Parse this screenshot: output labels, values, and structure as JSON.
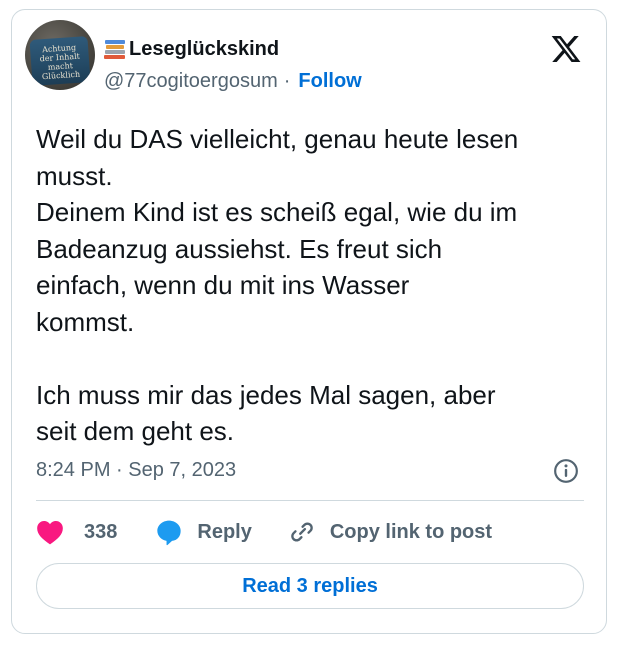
{
  "author": {
    "display_name": "Leseglückskind",
    "name_emoji": "books-emoji",
    "handle": "@77cogitoergosum",
    "separator": "·",
    "follow_label": "Follow",
    "avatar_mug_text": "Achtung\nder Inhalt\nmacht\nGlücklich"
  },
  "platform_logo": "x-logo-icon",
  "tweet": {
    "text": "Weil du DAS vielleicht, genau heute lesen\nmusst.\nDeinem Kind ist es scheiß egal, wie du im\nBadeanzug aussiehst. Es freut sich\neinfach, wenn du mit ins Wasser\nkommst.\n\nIch muss mir das jedes Mal sagen, aber\nseit dem geht es.",
    "timestamp": "8:24 PM · Sep 7, 2023"
  },
  "actions": {
    "like_count": "338",
    "reply_label": "Reply",
    "copy_link_label": "Copy link to post"
  },
  "read_replies_label": "Read 3 replies",
  "colors": {
    "link_blue": "#006fd6",
    "heart_pink": "#f91880",
    "reply_blue": "#1d9bf0",
    "muted_gray": "#536471",
    "text_dark": "#0f1419",
    "border": "#cfd9de"
  }
}
